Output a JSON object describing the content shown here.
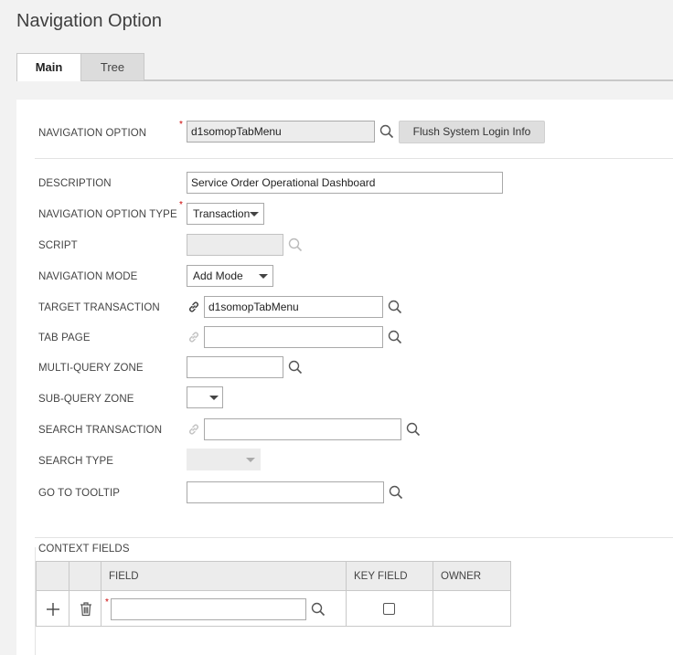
{
  "page": {
    "title": "Navigation Option"
  },
  "tabs": [
    {
      "label": "Main",
      "active": true
    },
    {
      "label": "Tree",
      "active": false
    }
  ],
  "header": {
    "navigation_option_label": "NAVIGATION OPTION",
    "navigation_option_value": "d1somopTabMenu",
    "flush_button_label": "Flush System Login Info"
  },
  "form": {
    "description": {
      "label": "DESCRIPTION",
      "value": "Service Order Operational Dashboard"
    },
    "navigation_option_type": {
      "label": "NAVIGATION OPTION TYPE",
      "value": "Transaction"
    },
    "script": {
      "label": "SCRIPT",
      "value": ""
    },
    "navigation_mode": {
      "label": "NAVIGATION MODE",
      "value": "Add Mode"
    },
    "target_transaction": {
      "label": "TARGET TRANSACTION",
      "value": "d1somopTabMenu"
    },
    "tab_page": {
      "label": "TAB PAGE",
      "value": ""
    },
    "multi_query_zone": {
      "label": "MULTI-QUERY ZONE",
      "value": ""
    },
    "sub_query_zone": {
      "label": "SUB-QUERY ZONE",
      "value": ""
    },
    "search_transaction": {
      "label": "SEARCH TRANSACTION",
      "value": ""
    },
    "search_type": {
      "label": "SEARCH TYPE",
      "value": ""
    },
    "go_to_tooltip": {
      "label": "GO TO TOOLTIP",
      "value": ""
    }
  },
  "context_fields": {
    "title": "CONTEXT FIELDS",
    "columns": [
      "",
      "",
      "FIELD",
      "KEY FIELD",
      "OWNER"
    ],
    "rows": [
      {
        "field": "",
        "key_field": false,
        "owner": ""
      }
    ]
  },
  "required_marker": "*",
  "icons": {
    "search": "search-icon",
    "link": "link-icon",
    "add": "plus-icon",
    "delete": "trash-icon"
  },
  "colors": {
    "required": "#cc0000",
    "panel_bg": "#ffffff",
    "page_bg": "#f2f2f2"
  }
}
